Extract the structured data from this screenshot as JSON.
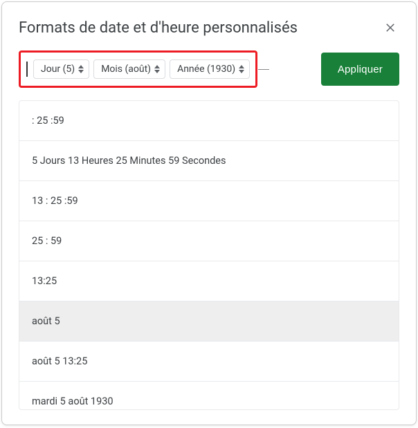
{
  "dialog": {
    "title": "Formats de date et d'heure personnalisés",
    "apply_label": "Appliquer"
  },
  "tokens": [
    {
      "label": "Jour (5)"
    },
    {
      "label": "Mois (août)"
    },
    {
      "label": "Année (1930)"
    }
  ],
  "formats": [
    {
      "text": ": 25 :59",
      "selected": false
    },
    {
      "text": "5 Jours 13 Heures 25 Minutes 59 Secondes",
      "selected": false
    },
    {
      "text": "13 : 25 :59",
      "selected": false
    },
    {
      "text": "25 : 59",
      "selected": false
    },
    {
      "text": "13:25",
      "selected": false
    },
    {
      "text": "août 5",
      "selected": true
    },
    {
      "text": "août 5 13:25",
      "selected": false
    },
    {
      "text": "mardi 5 août 1930",
      "selected": false
    }
  ]
}
